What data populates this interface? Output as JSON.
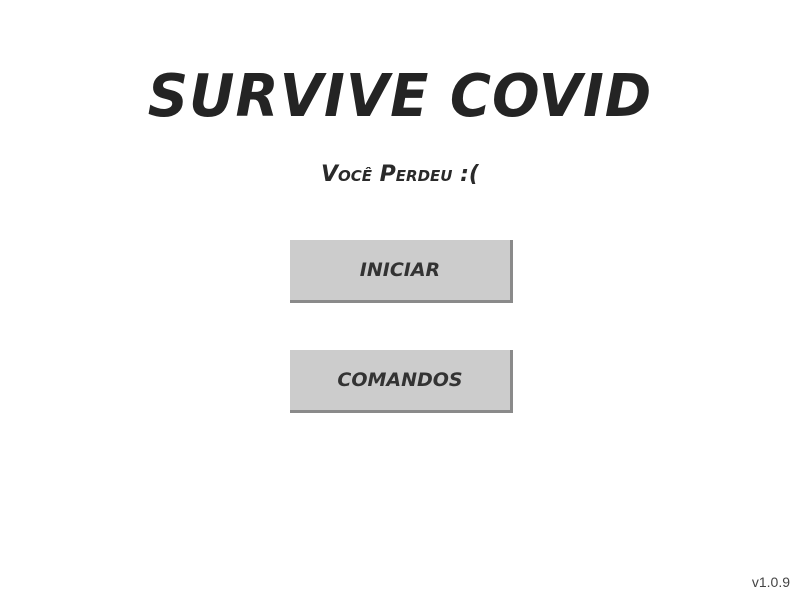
{
  "game": {
    "title": "SURVIVE COVID",
    "status_message": "Você Perdeu :(",
    "version": "v1.0.9"
  },
  "menu": {
    "start_label": "INICIAR",
    "commands_label": "COMANDOS"
  },
  "colors": {
    "background": "#ffffff",
    "text": "#242424",
    "button_face": "#cccccc",
    "button_shadow": "#8a8a8a"
  }
}
